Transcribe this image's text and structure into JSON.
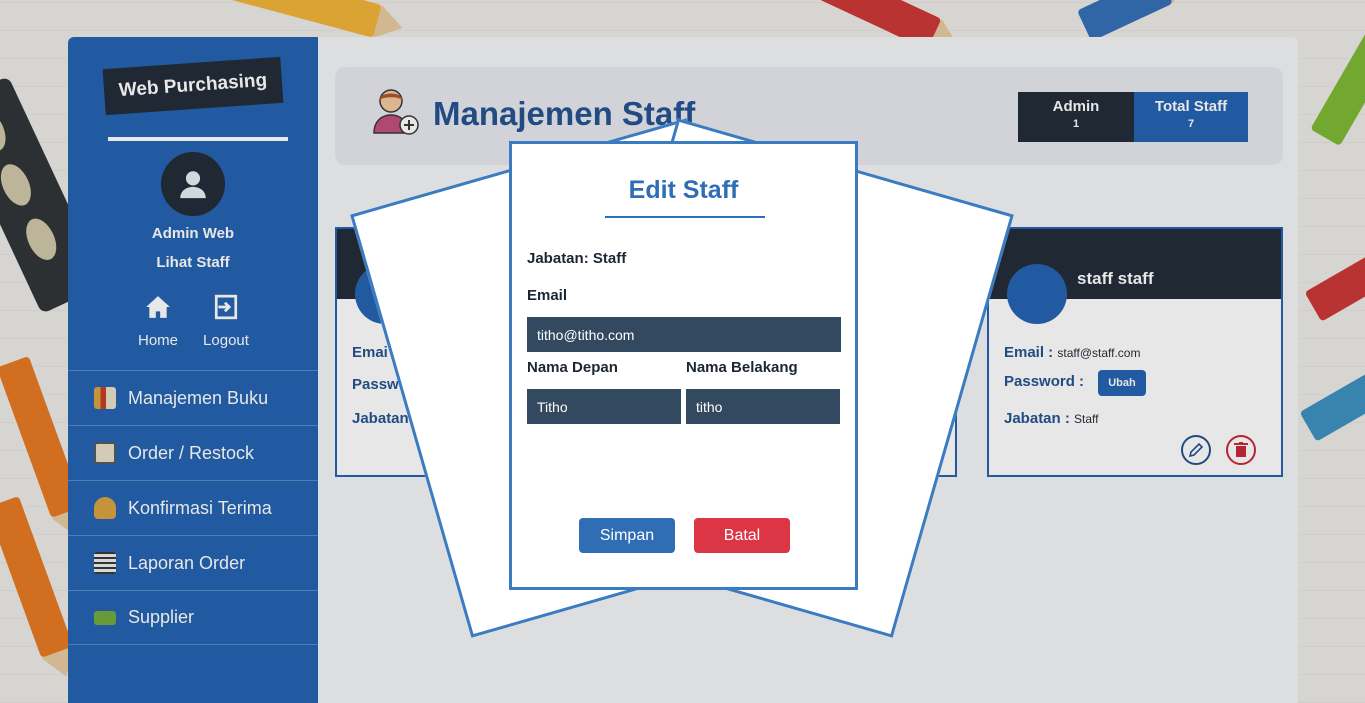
{
  "app": {
    "brand": "Web Purchasing"
  },
  "sidebar": {
    "user_name": "Admin Web",
    "user_link": "Lihat Staff",
    "quick": [
      {
        "label": "Home",
        "icon": "home-icon"
      },
      {
        "label": "Logout",
        "icon": "logout-icon"
      }
    ],
    "menu": [
      {
        "label": "Manajemen Buku",
        "icon": "books-icon"
      },
      {
        "label": "Order / Restock",
        "icon": "clipboard-icon"
      },
      {
        "label": "Konfirmasi Terima",
        "icon": "hand-box-icon"
      },
      {
        "label": "Laporan Order",
        "icon": "report-icon"
      },
      {
        "label": "Supplier",
        "icon": "truck-icon"
      }
    ]
  },
  "header": {
    "title": "Manajemen Staff",
    "stats": [
      {
        "label": "Admin",
        "value": "1"
      },
      {
        "label": "Total Staff",
        "value": "7"
      }
    ]
  },
  "cards": [
    {
      "email_label": "Emai",
      "password_label": "Passw",
      "jabatan_label": "Jabatan"
    },
    {
      "name": "staff staff",
      "email_label": "Email :",
      "email": "staff@staff.com",
      "password_label": "Password :",
      "password_button": "Ubah",
      "jabatan_label": "Jabatan :",
      "jabatan": "Staff"
    }
  ],
  "modal": {
    "title": "Edit Staff",
    "jabatan": "Jabatan: Staff",
    "email_label": "Email",
    "email_value": "titho@titho.com",
    "first_name_label": "Nama Depan",
    "first_name_value": "Titho",
    "last_name_label": "Nama Belakang",
    "last_name_value": "titho",
    "save_label": "Simpan",
    "cancel_label": "Batal"
  },
  "colors": {
    "sidebar": "#1e5fb0",
    "dark": "#1d2633",
    "input": "#334960",
    "save": "#2f6db5",
    "cancel": "#dc3545"
  }
}
